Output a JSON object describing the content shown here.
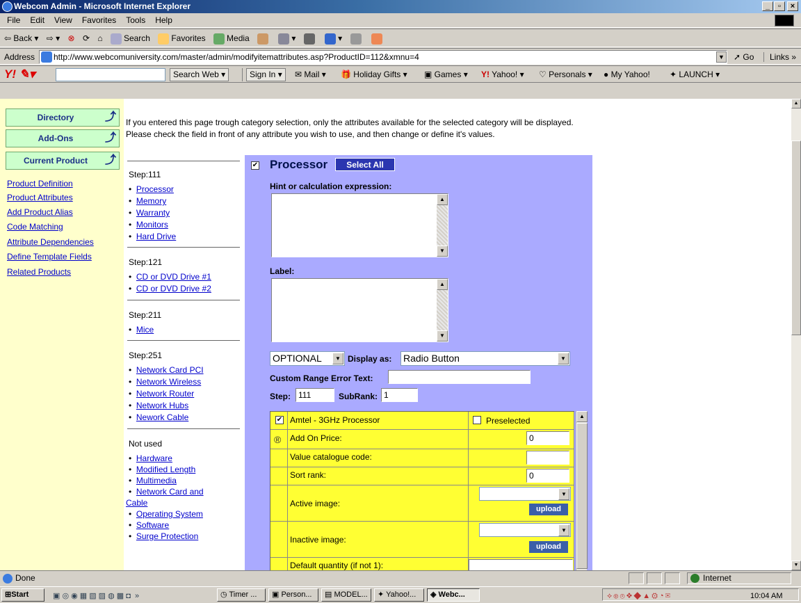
{
  "window": {
    "title": "Webcom Admin - Microsoft Internet Explorer"
  },
  "menu": [
    "File",
    "Edit",
    "View",
    "Favorites",
    "Tools",
    "Help"
  ],
  "toolbar": {
    "back": "Back",
    "search": "Search",
    "favorites": "Favorites",
    "media": "Media"
  },
  "address": {
    "label": "Address",
    "url": "http://www.webcomuniversity.com/master/admin/modifyitemattributes.asp?ProductID=112&xmnu=4",
    "go": "Go",
    "links": "Links"
  },
  "yahoo_bar": {
    "search_web": "Search Web",
    "sign_in": "Sign In",
    "items": [
      "Mail",
      "Holiday Gifts",
      "Games",
      "Yahoo!",
      "Personals",
      "My Yahoo!",
      "LAUNCH"
    ]
  },
  "sidebar": {
    "sections": [
      "Directory",
      "Add-Ons",
      "Current Product"
    ],
    "links": [
      "Product Definition",
      "Product Attributes",
      "Add Product Alias",
      "Code Matching",
      "Attribute Dependencies",
      "Define Template Fields",
      "Related Products"
    ]
  },
  "intro": "If you entered this page trough category selection, only the attributes available for the selected category will be displayed. Please check the field in front of any attribute you wish to use, and then change or define it's values.",
  "steps": [
    {
      "label": "Step:111",
      "items": [
        "Processor",
        "Memory",
        "Warranty",
        "Monitors",
        "Hard Drive"
      ]
    },
    {
      "label": "Step:121",
      "items": [
        "CD or DVD Drive #1",
        "CD or DVD Drive #2"
      ]
    },
    {
      "label": "Step:211",
      "items": [
        "Mice"
      ]
    },
    {
      "label": "Step:251",
      "items": [
        "Network Card PCI",
        "Network Wireless",
        "Network Router",
        "Network Hubs",
        "Nework Cable"
      ]
    },
    {
      "label": "Not used",
      "items": [
        "Hardware",
        "Modified Length",
        "Multimedia",
        "Network Card and",
        "Cable",
        "Operating System",
        "Software",
        "Surge Protection"
      ]
    }
  ],
  "panel": {
    "title": "Processor",
    "checked": true,
    "select_all": "Select All",
    "hint_label": "Hint or calculation expression:",
    "label_label": "Label:",
    "requirement": "OPTIONAL",
    "display_as_label": "Display as:",
    "display_as": "Radio Button",
    "custom_range_label": "Custom Range Error Text:",
    "custom_range_value": "",
    "step_label": "Step:",
    "step_value": "111",
    "subrank_label": "SubRank:",
    "subrank_value": "1"
  },
  "attribute": {
    "name": "Amtel - 3GHz Processor",
    "checked": true,
    "preselected_label": "Preselected",
    "preselected": false,
    "radio_symbol": "®",
    "add_on_price_label": "Add On Price:",
    "add_on_price": "0",
    "catalogue_code_label": "Value catalogue code:",
    "catalogue_code": "",
    "sort_rank_label": "Sort rank:",
    "sort_rank": "0",
    "active_image_label": "Active image:",
    "inactive_image_label": "Inactive image:",
    "upload": "upload",
    "default_qty_label": "Default quantity (if not 1):"
  },
  "status": {
    "text": "Done",
    "zone": "Internet"
  },
  "taskbar": {
    "start": "Start",
    "buttons": [
      "Timer ...",
      "Person...",
      "MODEL...",
      "Yahoo!...",
      "Webc..."
    ],
    "clock": "10:04 AM"
  }
}
